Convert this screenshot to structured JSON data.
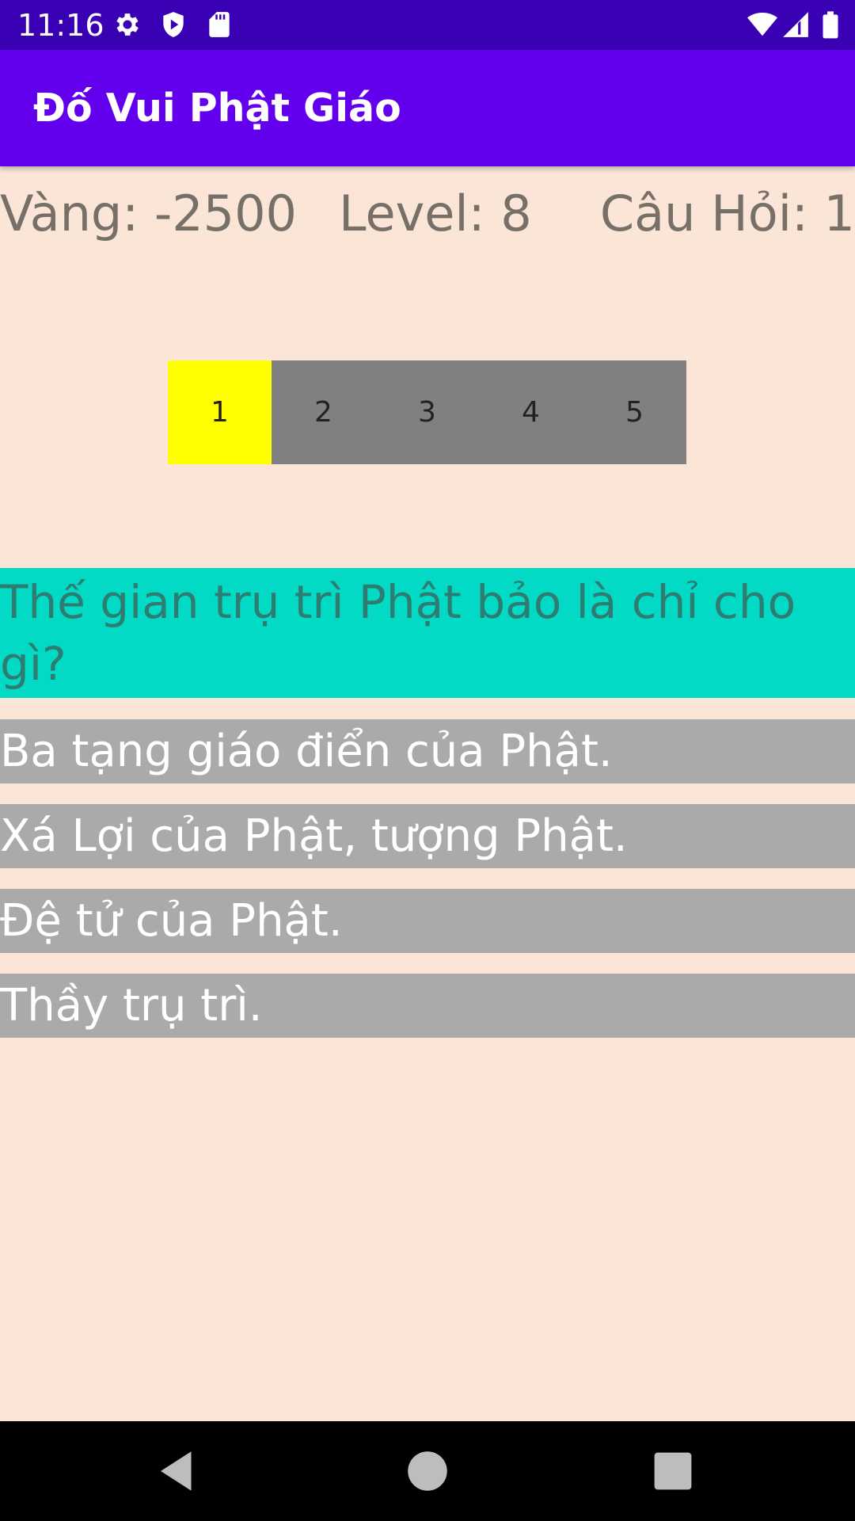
{
  "status_bar": {
    "time": "11:16",
    "icons": [
      "gear-icon",
      "shield-icon",
      "sd-card-icon",
      "wifi-icon",
      "signal-icon",
      "battery-icon"
    ]
  },
  "app_bar": {
    "title": "Đố Vui Phật Giáo",
    "color": "#6200EE"
  },
  "stats": {
    "gold": "Vàng: -2500",
    "level": "Level: 8",
    "question_no": "Câu Hỏi: 1"
  },
  "steps": {
    "items": [
      "1",
      "2",
      "3",
      "4",
      "5"
    ],
    "active_index": 0,
    "active_color": "#FFFF00",
    "inactive_color": "#808080"
  },
  "question": {
    "text": " Thế gian trụ trì Phật bảo là chỉ cho gì?",
    "background": "#03DAC5"
  },
  "answers": [
    "Ba tạng giáo điển của Phật.",
    "Xá Lợi của Phật, tượng Phật.",
    "Đệ tử của Phật.",
    "Thầy trụ trì."
  ],
  "nav_bar": {
    "buttons": [
      "back-icon",
      "home-icon",
      "recents-icon"
    ]
  },
  "colors": {
    "background": "#FAE5D6",
    "status_bar": "#3A00B3",
    "answer_background": "#AAAAAA"
  }
}
